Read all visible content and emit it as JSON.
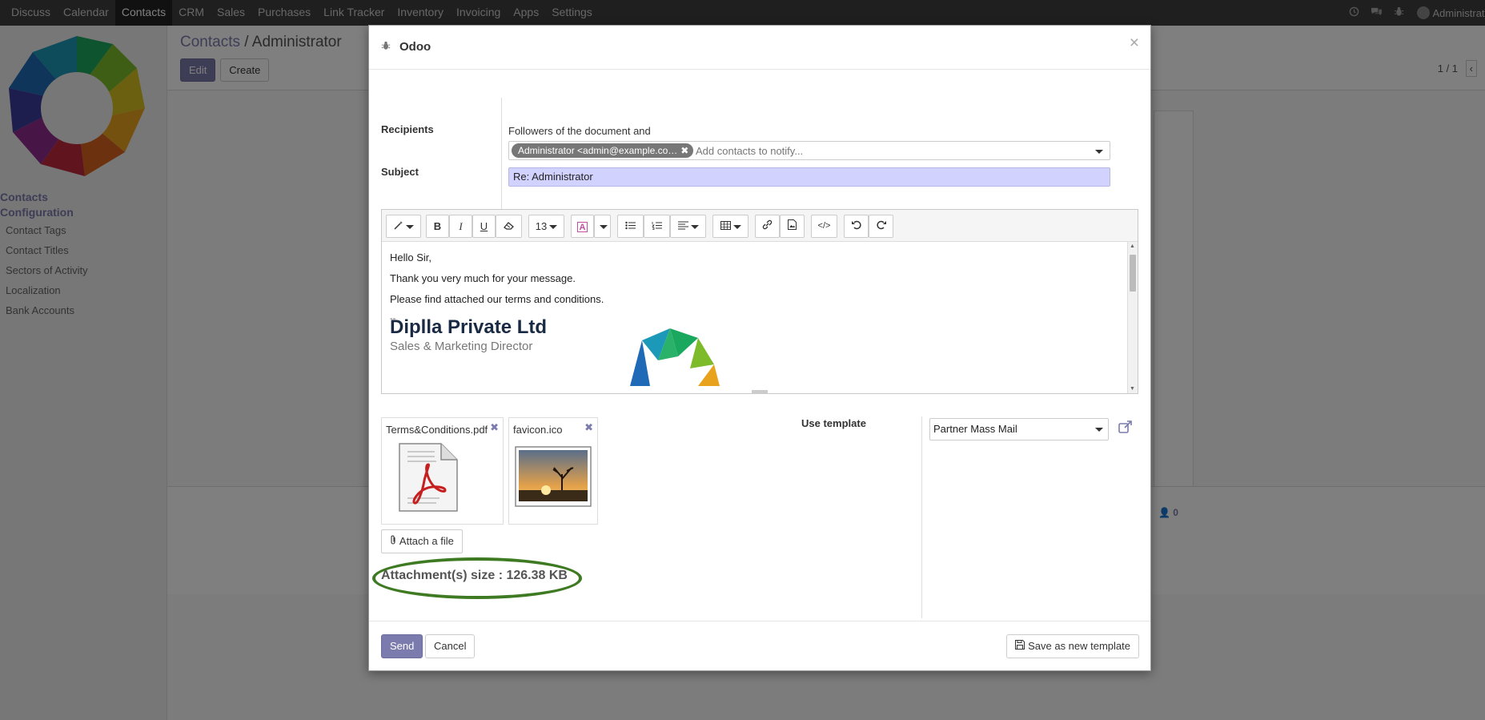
{
  "topnav": {
    "menu": [
      "Discuss",
      "Calendar",
      "Contacts",
      "CRM",
      "Sales",
      "Purchases",
      "Link Tracker",
      "Inventory",
      "Invoicing",
      "Apps",
      "Settings"
    ],
    "user": "Administrator (test"
  },
  "sidebar": {
    "section_contacts": "Contacts",
    "section_configuration": "Configuration",
    "items": [
      "Contact Tags",
      "Contact Titles",
      "Sectors of Activity",
      "Localization",
      "Bank Accounts"
    ]
  },
  "breadcrumb": {
    "parent": "Contacts",
    "separator": " / ",
    "current": "Administrator"
  },
  "buttons": {
    "edit": "Edit",
    "create": "Create"
  },
  "pager": "1 / 1",
  "background": {
    "followers_count": "0"
  },
  "modal": {
    "title": "Odoo",
    "close": "×",
    "recipients_label": "Recipients",
    "followers_text": "Followers of the document and",
    "recipient_tag": "Administrator <admin@example.co…",
    "recipient_placeholder": "Add contacts to notify...",
    "subject_label": "Subject",
    "subject_value": "Re: Administrator",
    "toolbar": {
      "font_size": "13"
    },
    "body": {
      "lines": [
        "Hello Sir,",
        "Thank you very much for your message.",
        "Please find attached our terms and conditions."
      ],
      "signature_separator": "--",
      "company": "Diplla Private Ltd",
      "job_title": "Sales & Marketing Director"
    },
    "attachments": [
      {
        "name": "Terms&Conditions.pdf",
        "icon": "pdf-file-icon"
      },
      {
        "name": "favicon.ico",
        "icon": "image-file-icon"
      }
    ],
    "attach_button": "Attach a file",
    "attachments_size": "Attachment(s) size : 126.38 KB",
    "use_template_label": "Use template",
    "template_value": "Partner Mass Mail",
    "send": "Send",
    "cancel": "Cancel",
    "save_template": "Save as new template"
  },
  "colors": {
    "accent": "#7c7bad",
    "topnav": "#3e3e3e",
    "subject_bg": "#d2d2ff",
    "highlight_oval": "#3e7a22"
  }
}
